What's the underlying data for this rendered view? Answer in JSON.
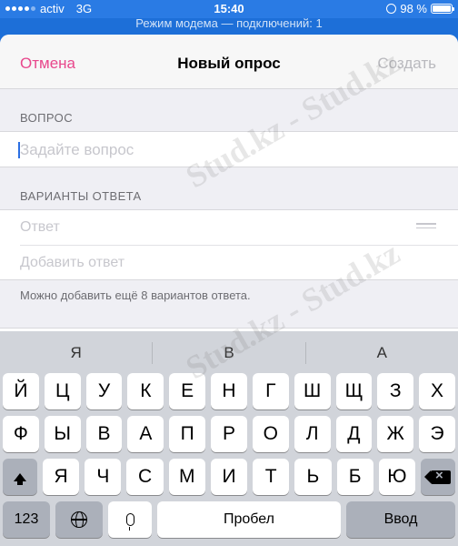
{
  "status_bar": {
    "carrier": "activ",
    "network": "3G",
    "time": "15:40",
    "battery_text": "98 %",
    "battery_level": 0.98
  },
  "hotspot": {
    "text": "Режим модема — подключений: 1"
  },
  "nav": {
    "cancel_label": "Отмена",
    "title": "Новый опрос",
    "create_label": "Создать"
  },
  "question": {
    "header": "ВОПРОС",
    "placeholder": "Задайте вопрос"
  },
  "answers": {
    "header": "ВАРИАНТЫ ОТВЕТА",
    "items": [
      {
        "placeholder": "Ответ"
      },
      {
        "placeholder": "Добавить ответ"
      }
    ],
    "footnote": "Можно добавить ещё 8 вариантов ответа."
  },
  "keyboard": {
    "predictions": [
      "Я",
      "В",
      "А"
    ],
    "row1": [
      "Й",
      "Ц",
      "У",
      "К",
      "Е",
      "Н",
      "Г",
      "Ш",
      "Щ",
      "З",
      "Х"
    ],
    "row2": [
      "Ф",
      "Ы",
      "В",
      "А",
      "П",
      "Р",
      "О",
      "Л",
      "Д",
      "Ж",
      "Э"
    ],
    "row3": [
      "Я",
      "Ч",
      "С",
      "М",
      "И",
      "Т",
      "Ь",
      "Б",
      "Ю"
    ],
    "numbers_label": "123",
    "space_label": "Пробел",
    "enter_label": "Ввод"
  },
  "watermark": "Stud.kz - Stud.kz",
  "colors": {
    "accent_pink": "#e8478c",
    "toggle_green": "#4cd964",
    "status_blue": "#2a7be4"
  }
}
